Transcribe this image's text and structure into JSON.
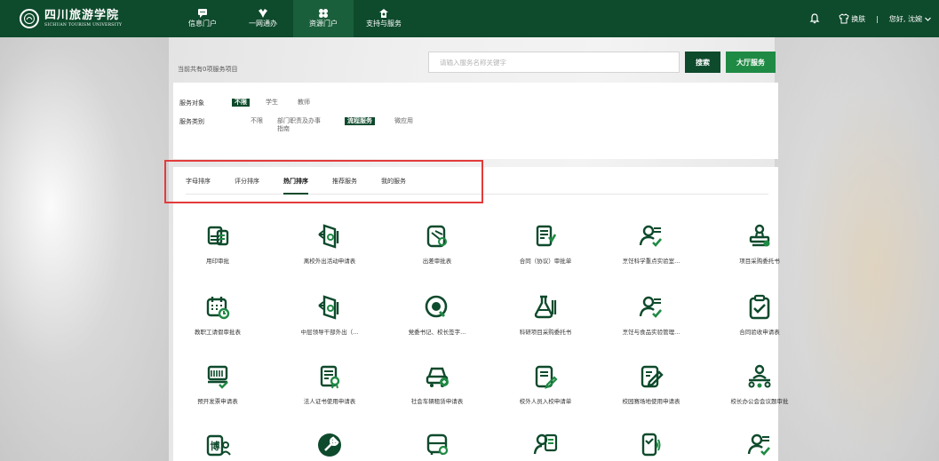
{
  "header": {
    "logo_cn": "四川旅游学院",
    "logo_en": "SICHUAN TOURISM UNIVERSITY",
    "nav": [
      {
        "label": "信息门户",
        "icon": "message-icon",
        "active": false
      },
      {
        "label": "一网通办",
        "icon": "handshake-icon",
        "active": false
      },
      {
        "label": "资源门户",
        "icon": "clover-icon",
        "active": true
      },
      {
        "label": "支持与服务",
        "icon": "support-icon",
        "active": false
      }
    ],
    "skin_label": "换肤",
    "separator": "|",
    "user_label": "您好, 沈婉"
  },
  "search": {
    "placeholder": "请输入服务名称关键字",
    "search_label": "搜索",
    "hall_label": "大厅服务"
  },
  "count_text": "当前共有0项服务项目",
  "filters": {
    "target_label": "服务对象",
    "target_options": [
      {
        "label": "不限",
        "active": true
      },
      {
        "label": "学生",
        "active": false
      },
      {
        "label": "教师",
        "active": false
      }
    ],
    "category_label": "服务类别",
    "category_options": [
      {
        "label": "不限",
        "active": false
      },
      {
        "label": "部门职责及办事指南",
        "active": false
      },
      {
        "label": "流程服务",
        "active": true
      },
      {
        "label": "微应用",
        "active": false
      }
    ]
  },
  "tabs": [
    {
      "label": "字母排序",
      "active": false
    },
    {
      "label": "评分排序",
      "active": false
    },
    {
      "label": "热门排序",
      "active": true
    },
    {
      "label": "推荐服务",
      "active": false
    },
    {
      "label": "我的服务",
      "active": false
    }
  ],
  "colors": {
    "primary": "#0e4a2c",
    "accent": "#1f8a44",
    "highlight": "#e33b3b"
  },
  "services": [
    {
      "name": "用印审批",
      "icon": "stamp-doc-icon"
    },
    {
      "name": "离校外出活动申请表",
      "icon": "door-exit-icon"
    },
    {
      "name": "出差审批表",
      "icon": "travel-icon"
    },
    {
      "name": "合同（协议）审批单",
      "icon": "contract-icon"
    },
    {
      "name": "烹饪科学重点实验室...",
      "icon": "person-check-icon"
    },
    {
      "name": "项目采购委托书",
      "icon": "stamp-icon"
    },
    {
      "name": "教职工请假审批表",
      "icon": "calendar-leave-icon"
    },
    {
      "name": "中层领导干部外出（...",
      "icon": "door-exit-icon"
    },
    {
      "name": "党委书记、校长签字...",
      "icon": "sign-icon"
    },
    {
      "name": "科研项目采购委托书",
      "icon": "flask-doc-icon"
    },
    {
      "name": "烹饪与食品实验管理...",
      "icon": "person-check-icon"
    },
    {
      "name": "合同验收申请表",
      "icon": "clipboard-check-icon"
    },
    {
      "name": "预开发票申请表",
      "icon": "invoice-icon"
    },
    {
      "name": "法人证书使用申请表",
      "icon": "certificate-icon"
    },
    {
      "name": "社会车辆租赁申请表",
      "icon": "car-rent-icon"
    },
    {
      "name": "校外人员入校申请单",
      "icon": "doc-edit-icon"
    },
    {
      "name": "校园赛场地使用申请表",
      "icon": "doc-pen-icon"
    },
    {
      "name": "校长办公会会议题审批",
      "icon": "meeting-icon"
    },
    {
      "name": "",
      "icon": "doctor-icon"
    },
    {
      "name": "",
      "icon": "wrench-icon"
    },
    {
      "name": "",
      "icon": "bus-icon"
    },
    {
      "name": "",
      "icon": "person-doc-icon"
    },
    {
      "name": "",
      "icon": "phone-icon"
    },
    {
      "name": "",
      "icon": "person-check-icon"
    }
  ]
}
